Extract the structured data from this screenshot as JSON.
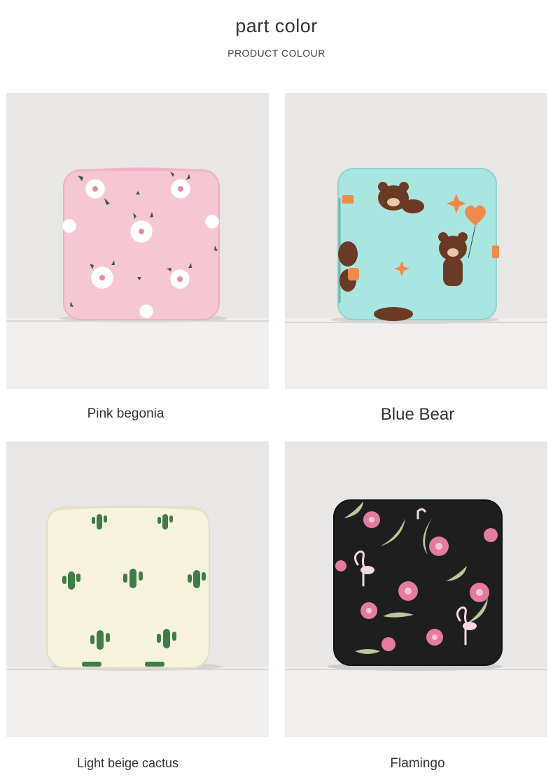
{
  "header": {
    "title": "part color",
    "subtitle": "PRODUCT COLOUR"
  },
  "products": [
    {
      "name": "Pink begonia",
      "pattern": "white-flower-icon",
      "color": "#f6c6d2"
    },
    {
      "name": "Blue Bear",
      "pattern": "brown-bear-icon",
      "color": "#a8e6df"
    },
    {
      "name": "Light beige cactus",
      "pattern": "cactus-icon",
      "color": "#f6f2de"
    },
    {
      "name": "Flamingo",
      "pattern": "flamingo-icon",
      "color": "#1e1e1e"
    }
  ],
  "colors": {
    "background": "#ffffff",
    "photo_wall": "#e9e6e6",
    "photo_shelf": "#f1efee"
  }
}
